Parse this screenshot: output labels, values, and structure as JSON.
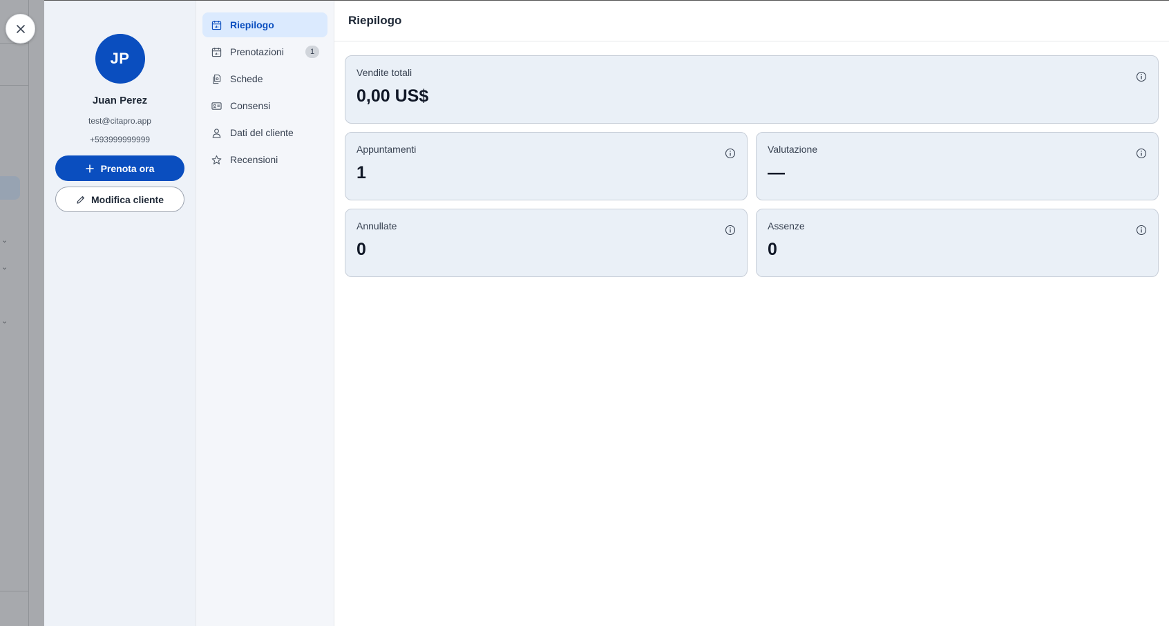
{
  "profile": {
    "initials": "JP",
    "name": "Juan Perez",
    "email": "test@citapro.app",
    "phone": "+593999999999",
    "book_label": "Prenota ora",
    "edit_label": "Modifica cliente",
    "avatar_color": "#0a4ebf"
  },
  "nav": {
    "items": [
      {
        "label": "Riepilogo",
        "icon": "calendar-stats-icon",
        "active": true
      },
      {
        "label": "Prenotazioni",
        "icon": "calendar-icon",
        "badge": "1"
      },
      {
        "label": "Schede",
        "icon": "documents-icon"
      },
      {
        "label": "Consensi",
        "icon": "id-card-icon"
      },
      {
        "label": "Dati del cliente",
        "icon": "user-icon"
      },
      {
        "label": "Recensioni",
        "icon": "star-icon"
      }
    ]
  },
  "main": {
    "title": "Riepilogo",
    "cards": [
      {
        "title": "Vendite totali",
        "value": "0,00 US$"
      },
      {
        "title": "Appuntamenti",
        "value": "1"
      },
      {
        "title": "Valutazione",
        "value": "—"
      },
      {
        "title": "Annullate",
        "value": "0"
      },
      {
        "title": "Assenze",
        "value": "0"
      }
    ]
  }
}
